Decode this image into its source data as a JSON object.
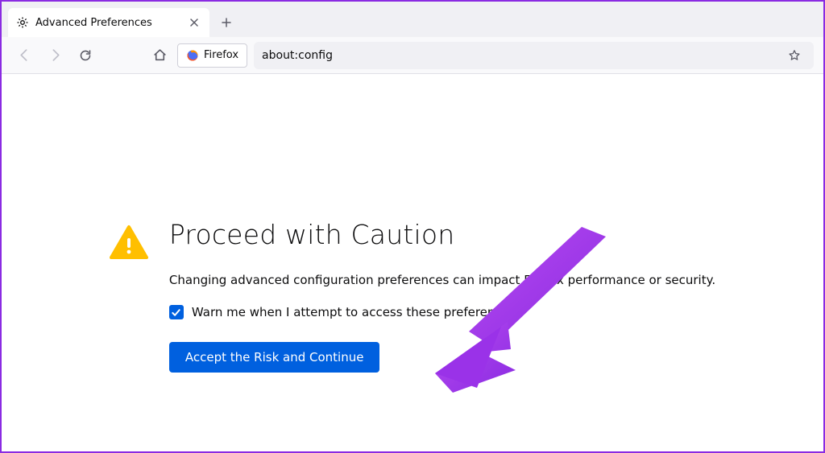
{
  "tab": {
    "title": "Advanced Preferences"
  },
  "urlbar": {
    "identity_label": "Firefox",
    "url": "about:config"
  },
  "warning": {
    "title": "Proceed with Caution",
    "description": "Changing advanced configuration preferences can impact Firefox performance or security.",
    "checkbox_label": "Warn me when I attempt to access these preferences",
    "checkbox_checked": true,
    "accept_button": "Accept the Risk and Continue"
  },
  "colors": {
    "accent": "#0060df",
    "warn": "#ffbf00",
    "annotation": "#a020f0"
  }
}
